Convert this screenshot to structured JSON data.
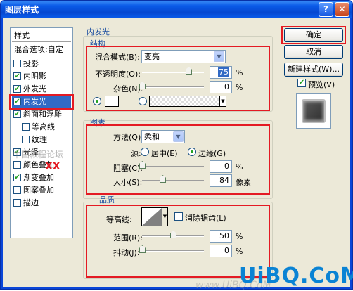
{
  "window": {
    "title": "图层样式",
    "help_label": "?",
    "close_label": "✕"
  },
  "style_list": {
    "header": "样式",
    "blend_options": "混合选项:自定",
    "items": [
      {
        "label": "投影",
        "checked": false,
        "check": ""
      },
      {
        "label": "内阴影",
        "checked": true,
        "check": "✔"
      },
      {
        "label": "外发光",
        "checked": true,
        "check": "✔"
      },
      {
        "label": "内发光",
        "checked": true,
        "check": "✔",
        "selected": true
      },
      {
        "label": "斜面和浮雕",
        "checked": true,
        "check": "✔"
      },
      {
        "label": "等高线",
        "checked": false,
        "check": ""
      },
      {
        "label": "纹理",
        "checked": false,
        "check": ""
      },
      {
        "label": "光泽",
        "checked": true,
        "check": "✔"
      },
      {
        "label": "颜色叠加",
        "checked": false,
        "check": ""
      },
      {
        "label": "渐变叠加",
        "checked": true,
        "check": "✔"
      },
      {
        "label": "图案叠加",
        "checked": false,
        "check": ""
      },
      {
        "label": "描边",
        "checked": false,
        "check": ""
      }
    ]
  },
  "panel": {
    "title": "内发光",
    "structure": {
      "title": "结构",
      "blend_mode_label": "混合模式(B):",
      "blend_mode_value": "变亮",
      "opacity_label": "不透明度(O):",
      "opacity_value": "75",
      "opacity_unit": "%",
      "opacity_level": 0.75,
      "noise_label": "杂色(N):",
      "noise_value": "0",
      "noise_unit": "%",
      "noise_level": 0
    },
    "elements": {
      "title": "图素",
      "technique_label": "方法(Q):",
      "technique_value": "柔和",
      "source_label": "源:",
      "source_center": "居中(E)",
      "source_edge": "边缘(G)",
      "source_selected": "edge",
      "choke_label": "阻塞(C):",
      "choke_value": "0",
      "choke_unit": "%",
      "choke_level": 0,
      "size_label": "大小(S):",
      "size_value": "84",
      "size_unit": "像素",
      "size_level": 0.33
    },
    "quality": {
      "title": "品质",
      "contour_label": "等高线:",
      "anti_alias_label": "消除锯齿(L)",
      "anti_alias_checked": false,
      "range_label": "范围(R):",
      "range_value": "50",
      "range_unit": "%",
      "range_level": 0.5,
      "jitter_label": "抖动(J):",
      "jitter_value": "0",
      "jitter_unit": "%",
      "jitter_level": 0
    }
  },
  "buttons": {
    "ok": "确定",
    "cancel": "取消",
    "new_style": "新建样式(W)...",
    "preview_label": "预览(V)",
    "preview_checked": true,
    "preview_check": "✔"
  },
  "watermarks": {
    "forum": "中国教程论坛",
    "xx": "XX",
    "url": "www.UiBQ.CoM",
    "brand": "UiBQ.CoM"
  },
  "colors": {
    "accent": "#316ac5",
    "highlight_box": "#e41a23",
    "group_title": "#1d4fa0",
    "brand": "#0a83d4"
  }
}
